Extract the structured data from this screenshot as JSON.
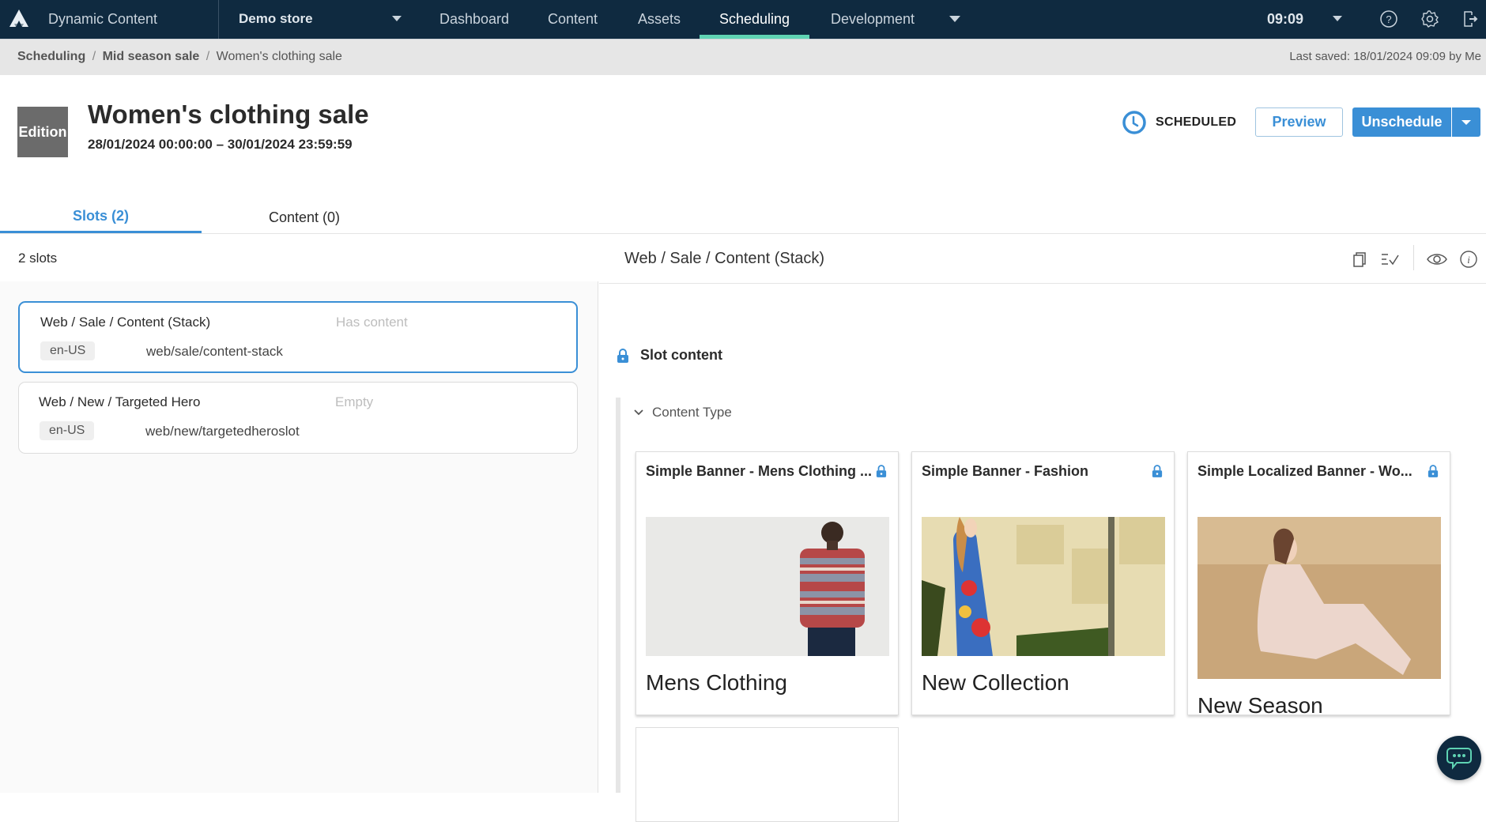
{
  "nav": {
    "app_name": "Dynamic Content",
    "store": "Demo store",
    "items": [
      {
        "label": "Dashboard",
        "active": false
      },
      {
        "label": "Content",
        "active": false
      },
      {
        "label": "Assets",
        "active": false
      },
      {
        "label": "Scheduling",
        "active": true
      },
      {
        "label": "Development",
        "active": false
      }
    ],
    "time": "09:09",
    "icons": [
      "help-icon",
      "settings-icon",
      "logout-icon"
    ]
  },
  "breadcrumb": {
    "items": [
      "Scheduling",
      "Mid season sale",
      "Women's clothing sale"
    ],
    "last_saved": "Last saved: 18/01/2024 09:09 by Me"
  },
  "header": {
    "badge": "Edition",
    "title": "Women's clothing sale",
    "date_range": "28/01/2024 00:00:00  –  30/01/2024 23:59:59",
    "status": "SCHEDULED",
    "preview_label": "Preview",
    "unschedule_label": "Unschedule"
  },
  "tabs": [
    {
      "label": "Slots (2)",
      "active": true
    },
    {
      "label": "Content (0)",
      "active": false
    }
  ],
  "slots": {
    "count_label": "2 slots",
    "items": [
      {
        "name": "Web / Sale / Content (Stack)",
        "state": "Has content",
        "locale": "en-US",
        "key": "web/sale/content-stack",
        "selected": true
      },
      {
        "name": "Web / New / Targeted Hero",
        "state": "Empty",
        "locale": "en-US",
        "key": "web/new/targetedheroslot",
        "selected": false
      }
    ]
  },
  "detail": {
    "title": "Web / Sale / Content (Stack)",
    "toolbar_icons": [
      "copy-icon",
      "validate-icon",
      "preview-eye-icon",
      "info-icon"
    ],
    "slot_content_label": "Slot content",
    "content_type_label": "Content Type",
    "cards": [
      {
        "title": "Simple Banner - Mens Clothing ...",
        "caption": "Mens Clothing",
        "image": "man-striped-sweater"
      },
      {
        "title": "Simple Banner - Fashion",
        "caption": "New Collection",
        "image": "woman-floral-dress-rocks"
      },
      {
        "title": "Simple Localized Banner - Wo...",
        "caption": "New Season",
        "image": "woman-sitting-wheat-field"
      }
    ]
  },
  "colors": {
    "nav_bg": "#0f2a40",
    "accent": "#3a8fd6",
    "active_tab_bar": "#5fd3b3"
  }
}
